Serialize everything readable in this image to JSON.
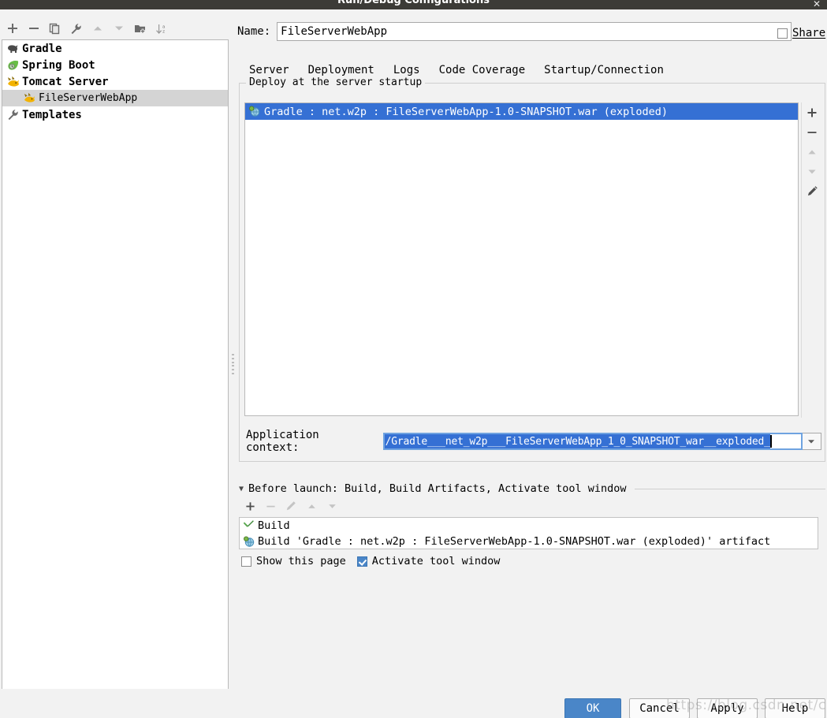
{
  "window": {
    "title": "Run/Debug Configurations",
    "close_icon": "close-icon"
  },
  "sidebar": {
    "toolbar": [
      {
        "name": "add-configuration-button",
        "icon": "plus-icon",
        "label": "+"
      },
      {
        "name": "remove-configuration-button",
        "icon": "minus-icon",
        "label": "−"
      },
      {
        "name": "copy-configuration-button",
        "icon": "copy-icon",
        "label": ""
      },
      {
        "name": "edit-templates-button",
        "icon": "wrench-icon",
        "label": ""
      },
      {
        "name": "move-up-button",
        "icon": "triangle-up-icon",
        "label": ""
      },
      {
        "name": "move-down-button",
        "icon": "triangle-down-icon",
        "label": ""
      },
      {
        "name": "move-into-folder-button",
        "icon": "folder-add-icon",
        "label": ""
      },
      {
        "name": "sort-configurations-button",
        "icon": "sort-az-icon",
        "label": ""
      }
    ],
    "tree": [
      {
        "label": "Gradle",
        "icon": "gradle-elephant-icon",
        "level": 0,
        "selected": false
      },
      {
        "label": "Spring Boot",
        "icon": "spring-leaf-icon",
        "level": 0,
        "selected": false
      },
      {
        "label": "Tomcat Server",
        "icon": "tomcat-cat-icon",
        "level": 0,
        "selected": false
      },
      {
        "label": "FileServerWebApp",
        "icon": "tomcat-cat-icon",
        "level": 1,
        "selected": true
      },
      {
        "label": "Templates",
        "icon": "wrench-icon",
        "level": 0,
        "selected": false
      }
    ]
  },
  "form": {
    "name_label": "Name:",
    "name_value": "FileServerWebApp",
    "share_label": "Share",
    "share_checked": false
  },
  "tabs": [
    {
      "label": "Server",
      "active": false
    },
    {
      "label": "Deployment",
      "active": true
    },
    {
      "label": "Logs",
      "active": false
    },
    {
      "label": "Code Coverage",
      "active": false
    },
    {
      "label": "Startup/Connection",
      "active": false
    }
  ],
  "deployment": {
    "group_title": "Deploy at the server startup",
    "artifacts": [
      {
        "label": "Gradle : net.w2p : FileServerWebApp-1.0-SNAPSHOT.war (exploded)",
        "icon": "artifact-globe-icon",
        "selected": true
      }
    ],
    "list_tools": [
      {
        "name": "add-artifact-button",
        "icon": "plus-icon",
        "glyph": "＋",
        "disabled": false
      },
      {
        "name": "remove-artifact-button",
        "icon": "minus-icon",
        "glyph": "−",
        "disabled": false
      },
      {
        "name": "move-artifact-up-button",
        "icon": "triangle-up-icon",
        "glyph": "▲",
        "disabled": true
      },
      {
        "name": "move-artifact-down-button",
        "icon": "triangle-down-icon",
        "glyph": "▼",
        "disabled": true
      },
      {
        "name": "edit-artifact-button",
        "icon": "pencil-icon",
        "glyph": "✎",
        "disabled": false
      }
    ],
    "context_label": "Application context:",
    "context_value": "/Gradle___net_w2p___FileServerWebApp_1_0_SNAPSHOT_war__exploded_",
    "context_dropdown_icon": "chevron-down-icon"
  },
  "before_launch": {
    "header": "Before launch: Build, Build Artifacts, Activate tool window",
    "collapse_icon": "triangle-down-icon",
    "tools": [
      {
        "name": "add-task-button",
        "icon": "plus-icon",
        "glyph": "＋",
        "disabled": false
      },
      {
        "name": "remove-task-button",
        "icon": "minus-icon",
        "glyph": "−",
        "disabled": true
      },
      {
        "name": "edit-task-button",
        "icon": "pencil-icon",
        "glyph": "✎",
        "disabled": true
      },
      {
        "name": "move-task-up-button",
        "icon": "triangle-up-icon",
        "glyph": "▲",
        "disabled": true
      },
      {
        "name": "move-task-down-button",
        "icon": "triangle-down-icon",
        "glyph": "▼",
        "disabled": true
      }
    ],
    "tasks": [
      {
        "label": "Build",
        "icon": "build-hammer-icon"
      },
      {
        "label": "Build 'Gradle : net.w2p : FileServerWebApp-1.0-SNAPSHOT.war (exploded)' artifact",
        "icon": "artifact-globe-icon"
      }
    ],
    "show_page_label": "Show this page",
    "show_page_checked": false,
    "activate_tool_window_label": "Activate tool window",
    "activate_tool_window_checked": true
  },
  "buttons": {
    "ok": "OK",
    "cancel": "Cancel",
    "apply": "Apply",
    "help": "Help"
  },
  "watermark": "https://blog.csdn.net/cbright",
  "colors": {
    "titlebar": "#3c3b37",
    "accent": "#4a86c8",
    "selection": "#3570d4",
    "panel": "#f2f2f2",
    "tree_selection": "#d4d4d4"
  }
}
